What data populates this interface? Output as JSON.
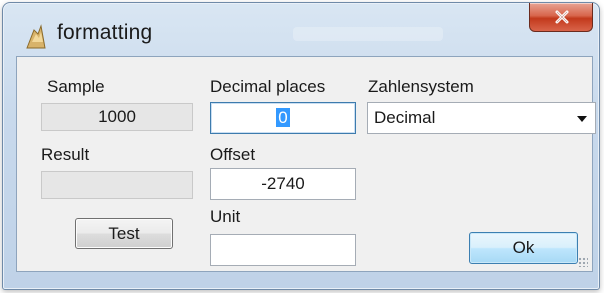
{
  "window": {
    "title": "formatting",
    "close_symbol": "x"
  },
  "form": {
    "sample": {
      "label": "Sample",
      "value": "1000"
    },
    "result": {
      "label": "Result",
      "value": ""
    },
    "decimal_places": {
      "label": "Decimal places",
      "value": "0"
    },
    "offset": {
      "label": "Offset",
      "value": "-2740"
    },
    "unit": {
      "label": "Unit",
      "value": ""
    },
    "number_system": {
      "label": "Zahlensystem",
      "selected": "Decimal"
    }
  },
  "buttons": {
    "test_label": "Test",
    "ok_label": "Ok"
  },
  "icons": {
    "window_icon": "app-icon",
    "close_icon": "close-icon",
    "dropdown_icon": "chevron-down-icon",
    "resize_icon": "resize-grip-icon"
  },
  "colors": {
    "close_button": "#c2391c",
    "selection": "#3399ff",
    "default_button_border": "#3c7fb1"
  }
}
